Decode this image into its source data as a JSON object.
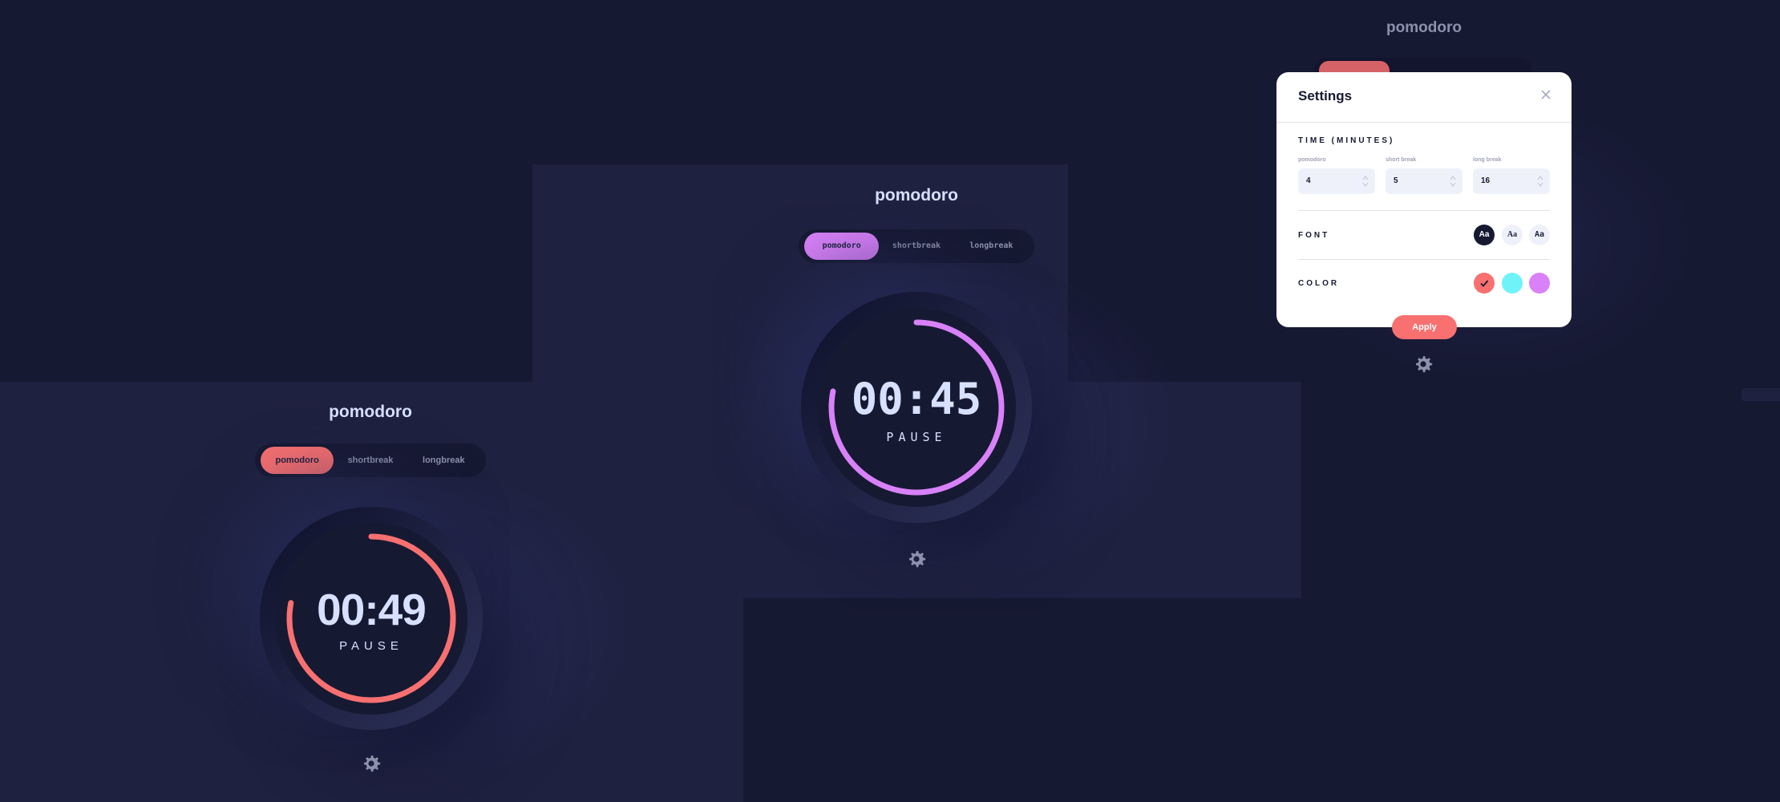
{
  "colors": {
    "bg": "#161932",
    "panel": "#1e213f",
    "text": "#d7e0ff",
    "muted": "#8d91ab",
    "red": "#f87070",
    "cyan": "#70f3f8",
    "purple": "#d881f8"
  },
  "screens": {
    "left": {
      "title": "pomodoro",
      "tabs": [
        "pomodoro",
        "shortbreak",
        "longbreak"
      ],
      "active_tab": "pomodoro",
      "time": "00:49",
      "action": "PAUSE",
      "progress": 0.78,
      "accent": "#f87070"
    },
    "center": {
      "title": "pomodoro",
      "tabs": [
        "pomodoro",
        "shortbreak",
        "longbreak"
      ],
      "active_tab": "pomodoro",
      "time": "00:45",
      "action": "PAUSE",
      "progress": 0.78,
      "accent": "#d881f8"
    },
    "right": {
      "title": "pomodoro"
    }
  },
  "settings": {
    "title": "Settings",
    "close_icon": "close-icon",
    "time_label": "TIME (MINUTES)",
    "fields": [
      {
        "label": "pomodoro",
        "value": "4"
      },
      {
        "label": "short break",
        "value": "5"
      },
      {
        "label": "long break",
        "value": "16"
      }
    ],
    "font_label": "FONT",
    "font_options": [
      "Aa",
      "Aa",
      "Aa"
    ],
    "selected_font": 0,
    "color_label": "COLOR",
    "color_options": [
      "#f87070",
      "#70f3f8",
      "#d881f8"
    ],
    "selected_color": 0,
    "apply_label": "Apply"
  }
}
